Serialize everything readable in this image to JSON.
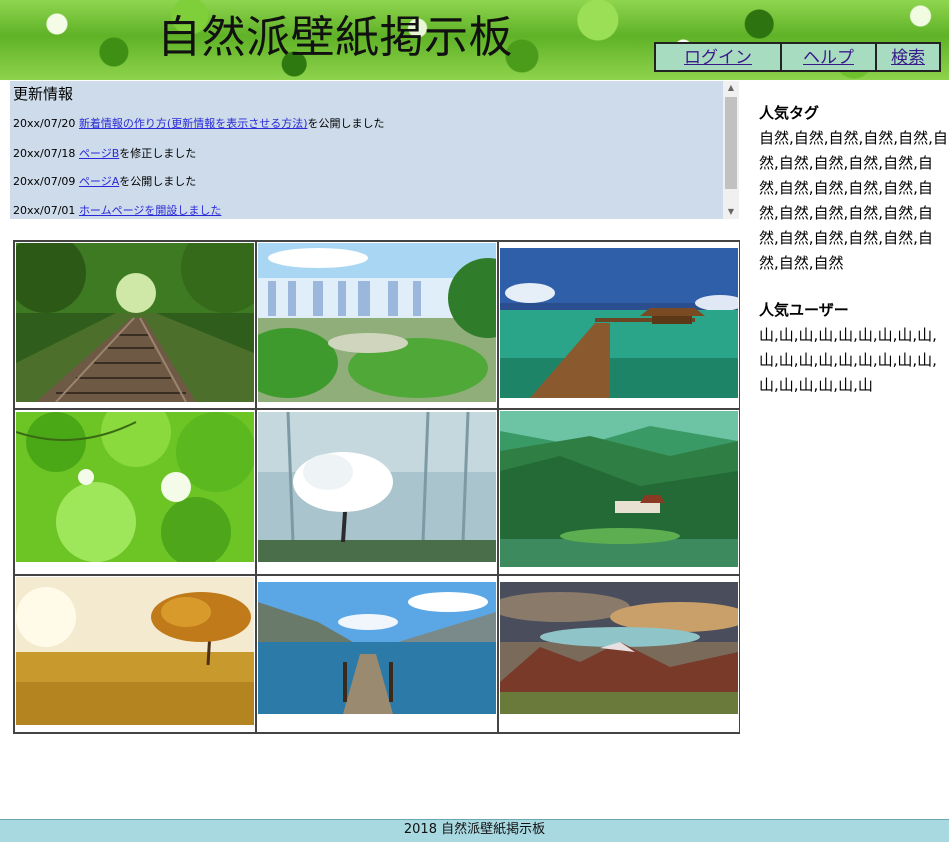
{
  "header": {
    "title": "自然派壁紙掲示板",
    "nav": [
      "ログイン",
      "ヘルプ",
      "検索"
    ]
  },
  "updates": {
    "title": "更新情報",
    "items": [
      {
        "date": "20xx/07/20",
        "link": "新着情報の作り方(更新情報を表示させる方法)",
        "suffix": "を公開しました"
      },
      {
        "date": "20xx/07/18",
        "link": "ページB",
        "suffix": "を修正しました"
      },
      {
        "date": "20xx/07/09",
        "link": "ページA",
        "suffix": "を公開しました"
      },
      {
        "date": "20xx/07/01",
        "link": "ホームページを開設しました",
        "suffix": ""
      }
    ]
  },
  "gallery": [
    {
      "subject": "railway track through forest"
    },
    {
      "subject": "waterfall"
    },
    {
      "subject": "overwater pier"
    },
    {
      "subject": "green leaves canopy"
    },
    {
      "subject": "white tree in foggy forest"
    },
    {
      "subject": "valley house by river"
    },
    {
      "subject": "tree in golden field"
    },
    {
      "subject": "wooden pier over lake"
    },
    {
      "subject": "mountain landscape at sunset"
    }
  ],
  "sidebar": {
    "tags_heading": "人気タグ",
    "tags": "自然,自然,自然,自然,自然,自然,自然,自然,自然,自然,自然,自然,自然,自然,自然,自然,自然,自然,自然,自然,自然,自然,自然,自然,自然,自然,自然,自然",
    "users_heading": "人気ユーザー",
    "users": "山,山,山,山,山,山,山,山,山,山,山,山,山,山,山,山,山,山,山,山,山,山,山,山"
  },
  "footer": {
    "text": "2018 自然派壁紙掲示板"
  }
}
